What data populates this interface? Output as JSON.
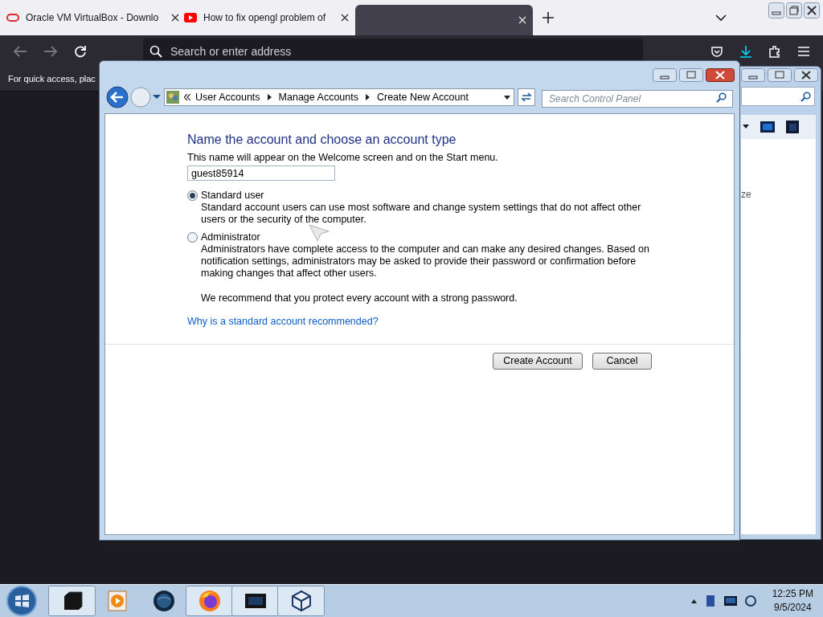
{
  "browser": {
    "tabs": [
      {
        "kind": "ring",
        "title": "Oracle VM VirtualBox - Downlo",
        "selected": false
      },
      {
        "kind": "video",
        "title": "How to fix opengl problem of",
        "selected": false
      },
      {
        "kind": "blank",
        "selected": true
      }
    ],
    "address_placeholder": "Search or enter address",
    "bookmarks_hint": "For quick access, plac"
  },
  "dialog": {
    "breadcrumb": [
      "User Accounts",
      "Manage Accounts",
      "Create New Account"
    ],
    "search_placeholder": "Search Control Panel",
    "heading": "Name the account and choose an account type",
    "description": "This name will appear on the Welcome screen and on the Start menu.",
    "account_name": "guest85914",
    "options": [
      {
        "label": "Standard user",
        "description": "Standard account users can use most software and change system settings that do not affect other users or the security of the computer.",
        "selected": true
      },
      {
        "label": "Administrator",
        "description": "Administrators have complete access to the computer and can make any desired changes. Based on notification settings, administrators may be asked to provide their password or confirmation before making changes that affect other users.",
        "selected": false
      }
    ],
    "recommendation": "We recommend that you protect every account with a strong password.",
    "help_link": "Why is a standard account recommended?",
    "buttons": [
      "Create Account",
      "Cancel"
    ]
  },
  "background_window": {
    "text": "ze"
  },
  "taskbar": {
    "apps": [
      {
        "kind": "box",
        "open": true
      },
      {
        "kind": "player",
        "open": false
      },
      {
        "kind": "globe",
        "open": false
      },
      {
        "kind": "firefox",
        "open": true
      },
      {
        "kind": "monitor",
        "open": true
      },
      {
        "kind": "cube",
        "open": true
      }
    ],
    "time": "12:25 PM",
    "date": "9/5/2024"
  }
}
